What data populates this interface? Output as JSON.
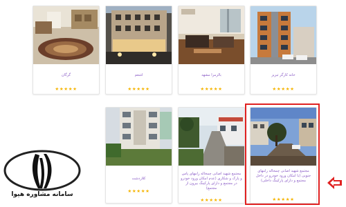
{
  "cards": [
    {
      "title": "گرگان",
      "rating": 5,
      "stars": "★★★★★"
    },
    {
      "title": "اشعم",
      "rating": 5,
      "stars": "★★★★★"
    },
    {
      "title": "بالزمرا مشهد",
      "rating": 5,
      "stars": "★★★★★"
    },
    {
      "title": "خانه کارگر تبریز",
      "rating": 5,
      "stars": "★★★★★"
    },
    {
      "title": "کلاردشت",
      "rating": 5,
      "stars": "★★★★★"
    },
    {
      "title": "مجتمع شهید اصانی چمخاله رامهای پاس و پارک و شکاری (عدم امکان ورود خودرو در مجتمع و دارای پارکینگ بیرون از مجتمع)",
      "rating": 5,
      "stars": "★★★★★"
    },
    {
      "title": "مجتمع شهید اصانی چمخاله رامهای جنوبی (با امکان ورود خودرو در داخل مجتمع و دارای پارکینگ داخلی)",
      "rating": 5,
      "stars": "★★★★★"
    }
  ],
  "logo": {
    "text": "سامانه مشاوره هیوا"
  },
  "colors": {
    "title": "#8a5cc6",
    "star": "#f5b400",
    "highlight": "#e02020"
  }
}
